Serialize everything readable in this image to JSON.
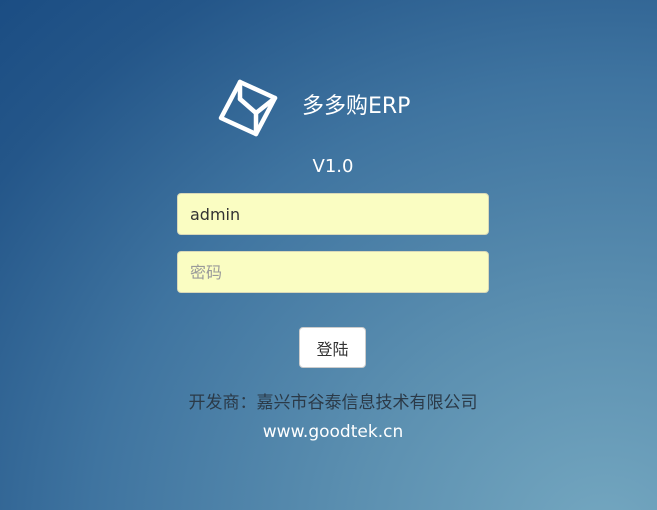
{
  "branding": {
    "logo_icon": "cube-icon",
    "app_name": "多多购ERP",
    "version": "V1.0"
  },
  "login_form": {
    "username_value": "admin",
    "password_placeholder": "密码",
    "submit_label": "登陆"
  },
  "footer": {
    "developer": "开发商：嘉兴市谷泰信息技术有限公司",
    "website": "www.goodtek.cn"
  },
  "colors": {
    "background_dark": "#1b4d83",
    "background_light": "#74a7c0",
    "input_background": "#fafdc2"
  }
}
